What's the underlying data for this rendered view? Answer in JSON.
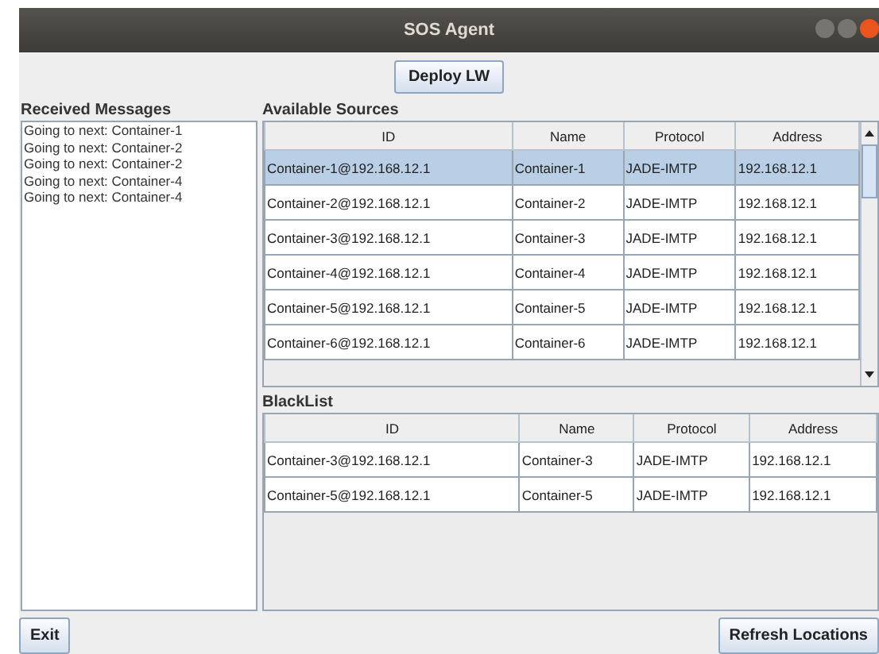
{
  "window": {
    "title": "SOS Agent"
  },
  "deploy_button": "Deploy LW",
  "received_messages": {
    "title": "Received Messages",
    "items": [
      "Going to next: Container-1",
      "Going to next: Container-2",
      "Going to next: Container-2",
      "Going to next: Container-4",
      "Going to next: Container-4"
    ]
  },
  "available_sources": {
    "title": "Available Sources",
    "columns": [
      "ID",
      "Name",
      "Protocol",
      "Address"
    ],
    "rows": [
      {
        "cells": [
          "Container-1@192.168.12.1",
          "Container-1",
          "JADE-IMTP",
          "192.168.12.1"
        ],
        "selected": true
      },
      {
        "cells": [
          "Container-2@192.168.12.1",
          "Container-2",
          "JADE-IMTP",
          "192.168.12.1"
        ],
        "selected": false
      },
      {
        "cells": [
          "Container-3@192.168.12.1",
          "Container-3",
          "JADE-IMTP",
          "192.168.12.1"
        ],
        "selected": false
      },
      {
        "cells": [
          "Container-4@192.168.12.1",
          "Container-4",
          "JADE-IMTP",
          "192.168.12.1"
        ],
        "selected": false
      },
      {
        "cells": [
          "Container-5@192.168.12.1",
          "Container-5",
          "JADE-IMTP",
          "192.168.12.1"
        ],
        "selected": false
      },
      {
        "cells": [
          "Container-6@192.168.12.1",
          "Container-6",
          "JADE-IMTP",
          "192.168.12.1"
        ],
        "selected": false
      }
    ]
  },
  "blacklist": {
    "title": "BlackList",
    "columns": [
      "ID",
      "Name",
      "Protocol",
      "Address"
    ],
    "rows": [
      {
        "cells": [
          "Container-3@192.168.12.1",
          "Container-3",
          "JADE-IMTP",
          "192.168.12.1"
        ],
        "selected": false
      },
      {
        "cells": [
          "Container-5@192.168.12.1",
          "Container-5",
          "JADE-IMTP",
          "192.168.12.1"
        ],
        "selected": false
      }
    ]
  },
  "buttons": {
    "exit": "Exit",
    "refresh": "Refresh Locations"
  }
}
